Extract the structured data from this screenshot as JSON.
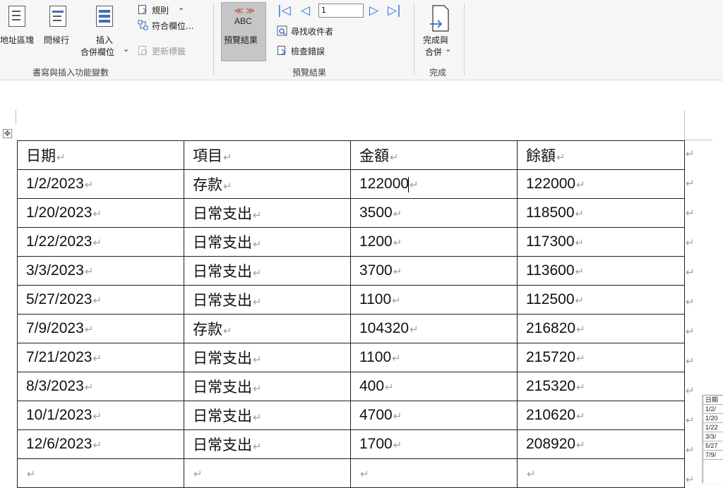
{
  "ribbon": {
    "group_write_insert": {
      "label": "書寫與插入功能變數",
      "address_block": "地址區塊",
      "greeting_line": "問候行",
      "insert_merge_field_line1": "插入",
      "insert_merge_field_line2": "合併欄位",
      "rules": "規則",
      "match_fields": "符合欄位...",
      "update_labels": "更新標籤"
    },
    "group_preview": {
      "label": "預覽結果",
      "preview_button_glyph": "ABC",
      "preview_button_label": "預覽結果",
      "record_number": "1",
      "find_recipient": "尋找收件者",
      "check_errors": "檢查錯誤"
    },
    "group_finish": {
      "label": "完成",
      "finish_merge_line1": "完成與",
      "finish_merge_line2": "合併"
    }
  },
  "icons": {
    "move_handle": "table-move-handle-icon",
    "paragraph_mark": "↵"
  },
  "colors": {
    "accent": "#2f6fd6",
    "preview_active_bg": "#c6c6c6",
    "chevron_red": "#c0392b"
  },
  "table": {
    "headers": [
      "日期",
      "項目",
      "金額",
      "餘額"
    ],
    "rows": [
      [
        "1/2/2023",
        "存款",
        "122000",
        "122000"
      ],
      [
        "1/20/2023",
        "日常支出",
        "3500",
        "118500"
      ],
      [
        "1/22/2023",
        "日常支出",
        "1200",
        "117300"
      ],
      [
        "3/3/2023",
        "日常支出",
        "3700",
        "113600"
      ],
      [
        "5/27/2023",
        "日常支出",
        "1100",
        "112500"
      ],
      [
        "7/9/2023",
        "存款",
        "104320",
        "216820"
      ],
      [
        "7/21/2023",
        "日常支出",
        "1100",
        "215720"
      ],
      [
        "8/3/2023",
        "日常支出",
        "400",
        "215320"
      ],
      [
        "10/1/2023",
        "日常支出",
        "4700",
        "210620"
      ],
      [
        "12/6/2023",
        "日常支出",
        "1700",
        "208920"
      ],
      [
        "",
        "",
        "",
        ""
      ]
    ]
  },
  "mini_preview": [
    "日期",
    "1/2/",
    "1/20",
    "1/22",
    "3/3/",
    "5/27",
    "7/9/"
  ]
}
